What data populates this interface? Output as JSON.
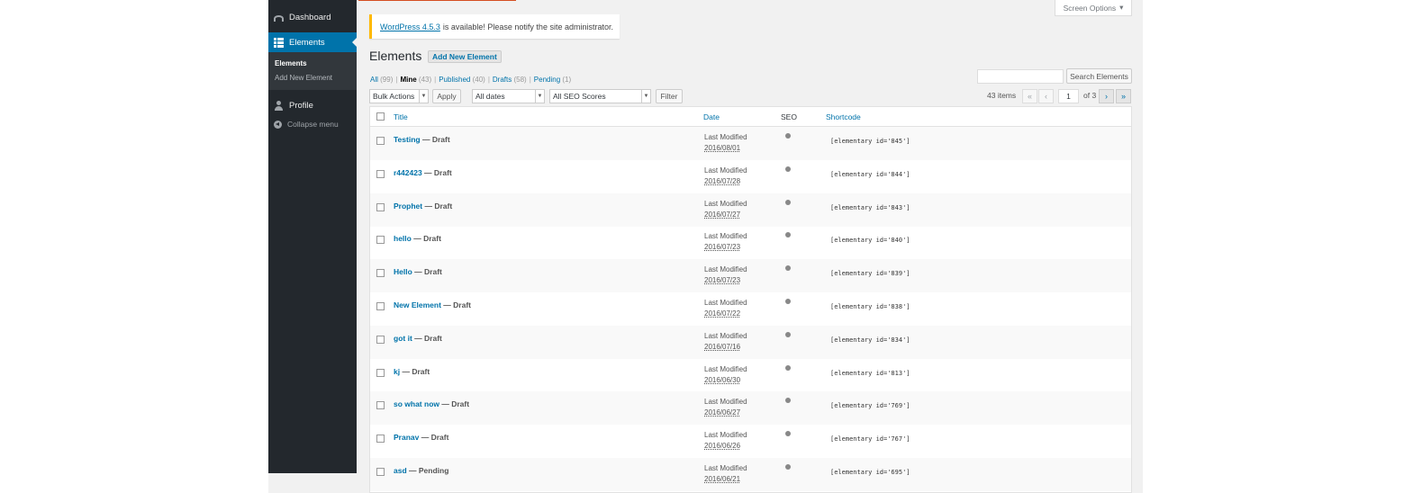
{
  "sidebar": {
    "items": [
      {
        "label": "Dashboard",
        "icon": "dashboard-icon"
      },
      {
        "label": "Elements",
        "icon": "grid-icon"
      },
      {
        "label": "Profile",
        "icon": "user-icon"
      },
      {
        "label": "Collapse menu",
        "icon": "collapse-icon"
      }
    ],
    "submenu": {
      "elements": "Elements",
      "add_new": "Add New Element"
    }
  },
  "screen_options": "Screen Options",
  "notice": {
    "link": "WordPress 4.5.3",
    "text": "is available! Please notify the site administrator."
  },
  "page_title": "Elements",
  "add_new_button": "Add New Element",
  "views": [
    {
      "label": "All",
      "count": "(99)"
    },
    {
      "label": "Mine",
      "count": "(43)"
    },
    {
      "label": "Published",
      "count": "(40)"
    },
    {
      "label": "Drafts",
      "count": "(58)"
    },
    {
      "label": "Pending",
      "count": "(1)"
    }
  ],
  "views_separator": "|",
  "search": {
    "button": "Search Elements",
    "value": ""
  },
  "filters": {
    "bulk_actions": "Bulk Actions",
    "apply": "Apply",
    "dates": "All dates",
    "seo": "All SEO Scores",
    "filter": "Filter"
  },
  "pagination": {
    "items": "43 items",
    "first": "«",
    "prev": "‹",
    "current": "1",
    "of": "of 3",
    "next": "›",
    "last": "»"
  },
  "columns": {
    "title": "Title",
    "date": "Date",
    "seo": "SEO",
    "shortcode": "Shortcode"
  },
  "date_label": "Last Modified",
  "rows": [
    {
      "title": "Testing",
      "status": "— Draft",
      "date": "2016/08/01",
      "shortcode": "[elementary id='845']"
    },
    {
      "title": "r442423",
      "status": "— Draft",
      "date": "2016/07/28",
      "shortcode": "[elementary id='844']"
    },
    {
      "title": "Prophet",
      "status": "— Draft",
      "date": "2016/07/27",
      "shortcode": "[elementary id='843']"
    },
    {
      "title": "hello",
      "status": "— Draft",
      "date": "2016/07/23",
      "shortcode": "[elementary id='840']"
    },
    {
      "title": "Hello",
      "status": "— Draft",
      "date": "2016/07/23",
      "shortcode": "[elementary id='839']"
    },
    {
      "title": "New Element",
      "status": "— Draft",
      "date": "2016/07/22",
      "shortcode": "[elementary id='838']"
    },
    {
      "title": "got it",
      "status": "— Draft",
      "date": "2016/07/16",
      "shortcode": "[elementary id='834']"
    },
    {
      "title": "kj",
      "status": "— Draft",
      "date": "2016/06/30",
      "shortcode": "[elementary id='813']"
    },
    {
      "title": "so what now",
      "status": "— Draft",
      "date": "2016/06/27",
      "shortcode": "[elementary id='769']"
    },
    {
      "title": "Pranav",
      "status": "— Draft",
      "date": "2016/06/26",
      "shortcode": "[elementary id='767']"
    },
    {
      "title": "asd",
      "status": "— Pending",
      "date": "2016/06/21",
      "shortcode": "[elementary id='695']"
    }
  ],
  "colors": {
    "sidebar": "#23282d",
    "accent": "#0073aa",
    "notice": "#ffb900",
    "background": "#f1f1f1"
  }
}
